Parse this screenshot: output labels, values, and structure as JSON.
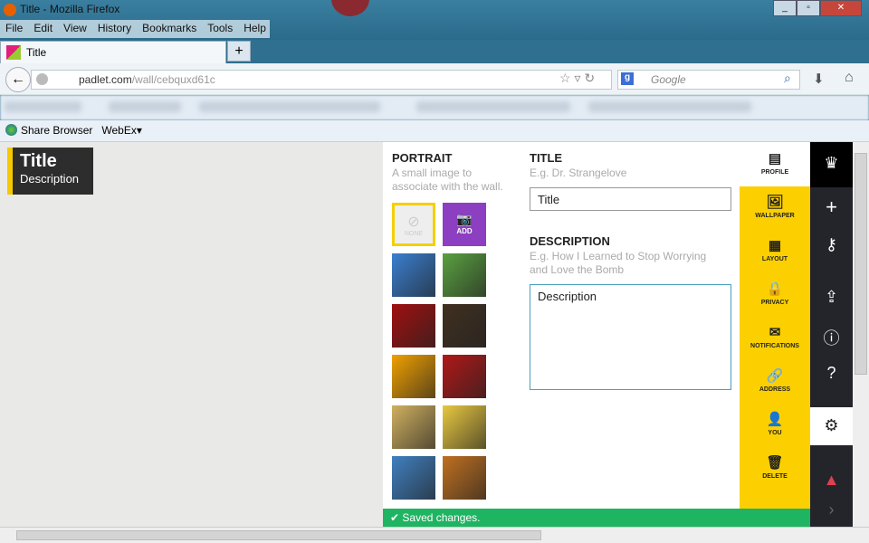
{
  "window": {
    "title": "Title - Mozilla Firefox"
  },
  "menu": [
    "File",
    "Edit",
    "View",
    "History",
    "Bookmarks",
    "Tools",
    "Help"
  ],
  "tab": {
    "label": "Title",
    "new_tab": "+"
  },
  "nav": {
    "url_domain": "padlet.com",
    "url_path": "/wall/cebquxd61c",
    "search_placeholder": "Google"
  },
  "bookmarks": [
    "Share Browser",
    "WebEx"
  ],
  "wall": {
    "title": "Title",
    "description": "Description"
  },
  "portrait": {
    "heading": "PORTRAIT",
    "hint": "A small image to associate with the wall.",
    "none_label": "NONE",
    "add_label": "ADD",
    "thumbs": [
      "#3a7fd0",
      "#5aa040",
      "#a01010",
      "#403020",
      "#f0a000",
      "#b01818",
      "#d0b060",
      "#e8c840",
      "#4080c0",
      "#c07020"
    ]
  },
  "form": {
    "title_heading": "TITLE",
    "title_hint": "E.g. Dr. Strangelove",
    "title_value": "Title",
    "desc_heading": "DESCRIPTION",
    "desc_hint": "E.g. How I Learned to Stop Worrying and Love the Bomb",
    "desc_value": "Description"
  },
  "settings": [
    {
      "label": "PROFILE",
      "icon": "▤"
    },
    {
      "label": "WALLPAPER",
      "icon": "🖼"
    },
    {
      "label": "LAYOUT",
      "icon": "▦"
    },
    {
      "label": "PRIVACY",
      "icon": "🔒"
    },
    {
      "label": "NOTIFICATIONS",
      "icon": "✉"
    },
    {
      "label": "ADDRESS",
      "icon": "🔗"
    },
    {
      "label": "YOU",
      "icon": "👤"
    },
    {
      "label": "DELETE",
      "icon": "🗑"
    }
  ],
  "status": "Saved changes."
}
